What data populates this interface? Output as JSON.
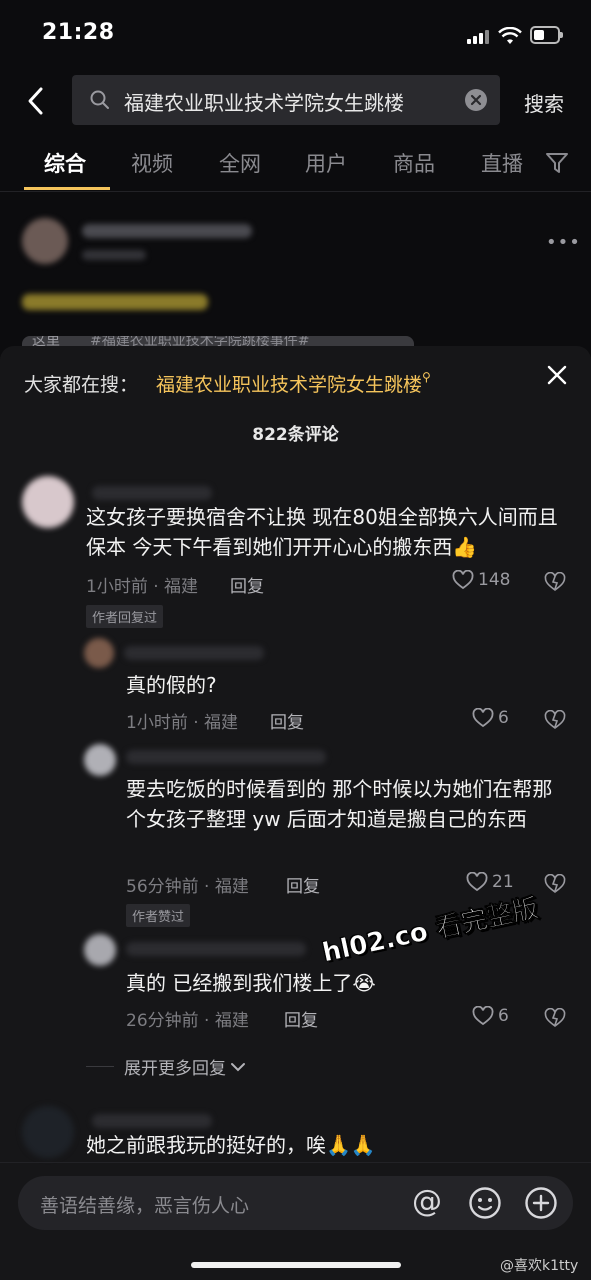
{
  "status": {
    "time": "21:28"
  },
  "search": {
    "query": "福建农业职业技术学院女生跳楼",
    "button": "搜索"
  },
  "tabs": [
    "综合",
    "视频",
    "全网",
    "用户",
    "商品",
    "直播"
  ],
  "background_card": {
    "tag_text": "#福建农业职业技术学院跳楼事件#",
    "tag_prefix": "这里"
  },
  "sheet": {
    "trending_label": "大家都在搜：",
    "trending_query": "福建农业职业技术学院女生跳楼",
    "comment_count": "822条评论"
  },
  "comments": {
    "main": {
      "text": "这女孩子要换宿舍不让换 现在80姐全部换六人间而且保本 今天下午看到她们开开心心的搬东西👍",
      "meta": "1小时前 · 福建",
      "reply": "回复",
      "likes": "148",
      "tag": "作者回复过"
    },
    "reply1": {
      "text": "真的假的?",
      "meta": "1小时前 · 福建",
      "reply": "回复",
      "likes": "6"
    },
    "reply2": {
      "text": "要去吃饭的时候看到的 那个时候以为她们在帮那个女孩子整理 yw 后面才知道是搬自己的东西",
      "meta": "56分钟前 · 福建",
      "reply": "回复",
      "likes": "21",
      "tag": "作者赞过"
    },
    "reply3": {
      "text": "真的 已经搬到我们楼上了😭",
      "meta": "26分钟前 · 福建",
      "reply": "回复",
      "likes": "6"
    },
    "expand": "展开更多回复",
    "next": {
      "text": "她之前跟我玩的挺好的，唉🙏🙏"
    }
  },
  "input": {
    "placeholder": "善语结善缘，恶言伤人心"
  },
  "watermark": "hl02.co 看完整版",
  "weibo_credit": "@喜欢k1tty",
  "colors": {
    "accent": "#f5c45b",
    "sheet_bg": "#161618",
    "page_bg": "#0c0c0e"
  }
}
